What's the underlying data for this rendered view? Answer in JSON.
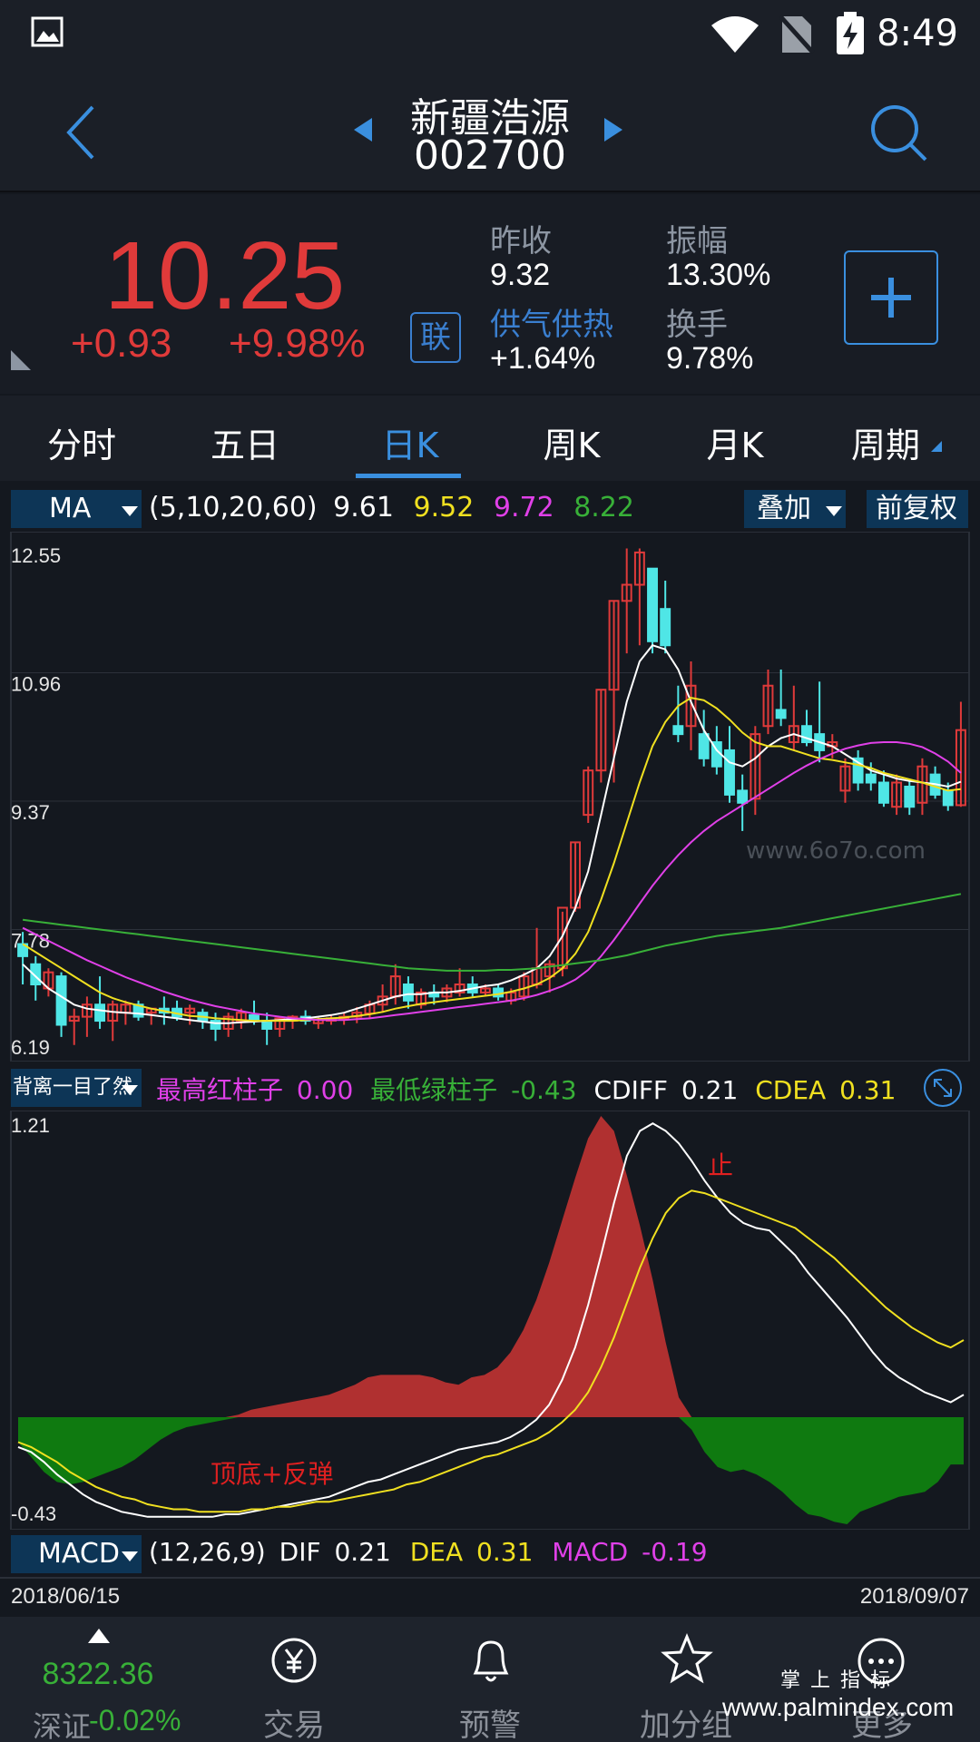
{
  "status_bar": {
    "time": "8:49"
  },
  "header": {
    "stock_name": "新疆浩源",
    "stock_code": "002700"
  },
  "quote": {
    "price": "10.25",
    "change": "+0.93",
    "change_pct": "+9.98%",
    "lian_badge": "联",
    "prev_close_label": "昨收",
    "prev_close": "9.32",
    "amplitude_label": "振幅",
    "amplitude": "13.30%",
    "sector_label": "供气供热",
    "sector_change": "+1.64%",
    "turnover_label": "换手",
    "turnover": "9.78%"
  },
  "tabs": [
    {
      "label": "分时"
    },
    {
      "label": "五日"
    },
    {
      "label": "日K"
    },
    {
      "label": "周K"
    },
    {
      "label": "月K"
    },
    {
      "label": "周期"
    }
  ],
  "active_tab": "日K",
  "ma_bar": {
    "selector": "MA",
    "params": "(5,10,20,60)",
    "ma5": "9.61",
    "ma10": "9.52",
    "ma20": "9.72",
    "ma60": "8.22",
    "overlay_btn": "叠加",
    "adjust_btn": "前复权"
  },
  "watermark": "www.6o7o.com",
  "ind_bar": {
    "selector": "背离一目了然",
    "red_label": "最高红柱子",
    "red_val": "0.00",
    "green_label": "最低绿柱子",
    "green_val": "-0.43",
    "cdiff_label": "CDIFF",
    "cdiff_val": "0.21",
    "cdea_label": "CDEA",
    "cdea_val": "0.31"
  },
  "annotations": {
    "stop": "止",
    "bounce": "顶底+反弹"
  },
  "macd_bar": {
    "selector": "MACD",
    "params": "(12,26,9)",
    "dif_label": "DIF",
    "dif_val": "0.21",
    "dea_label": "DEA",
    "dea_val": "0.31",
    "macd_label": "MACD",
    "macd_val": "-0.19"
  },
  "dates": {
    "start": "2018/06/15",
    "end": "2018/09/07"
  },
  "bottom_nav": {
    "index_value": "8322.36",
    "index_name": "深证",
    "index_change": "-0.02%",
    "items": [
      "交易",
      "预警",
      "加分组",
      "更多"
    ]
  },
  "bottom_watermark": {
    "top": "掌 上 指 标",
    "url": "www.palmindex.com"
  },
  "colors": {
    "up": "#e03a3a",
    "down": "#4fe6e6",
    "accent": "#3a8fdf",
    "ma5": "#ffffff",
    "ma10": "#f0e020",
    "ma20": "#e040e8",
    "ma60": "#38b038"
  },
  "chart_data": [
    {
      "type": "candlestick",
      "ylim": [
        6.19,
        12.55
      ],
      "y_ticks": [
        "12.55",
        "10.96",
        "9.37",
        "7.78",
        "6.19"
      ],
      "ohlc": [
        [
          7.6,
          7.75,
          7.1,
          7.45
        ],
        [
          7.35,
          7.45,
          6.9,
          7.1
        ],
        [
          7.05,
          7.3,
          6.95,
          7.25
        ],
        [
          7.2,
          7.25,
          6.45,
          6.6
        ],
        [
          6.65,
          6.8,
          6.35,
          6.7
        ],
        [
          6.7,
          6.95,
          6.45,
          6.85
        ],
        [
          6.85,
          7.2,
          6.55,
          6.65
        ],
        [
          6.65,
          6.9,
          6.4,
          6.85
        ],
        [
          6.75,
          6.9,
          6.6,
          6.85
        ],
        [
          6.85,
          6.9,
          6.65,
          6.7
        ],
        [
          6.75,
          6.8,
          6.6,
          6.8
        ],
        [
          6.8,
          6.95,
          6.6,
          6.75
        ],
        [
          6.8,
          6.9,
          6.65,
          6.7
        ],
        [
          6.75,
          6.85,
          6.6,
          6.8
        ],
        [
          6.75,
          6.8,
          6.55,
          6.65
        ],
        [
          6.65,
          6.75,
          6.4,
          6.55
        ],
        [
          6.55,
          6.75,
          6.45,
          6.7
        ],
        [
          6.65,
          6.8,
          6.55,
          6.75
        ],
        [
          6.72,
          6.9,
          6.6,
          6.65
        ],
        [
          6.65,
          6.75,
          6.35,
          6.55
        ],
        [
          6.55,
          6.7,
          6.45,
          6.68
        ],
        [
          6.65,
          6.72,
          6.55,
          6.7
        ],
        [
          6.7,
          6.78,
          6.6,
          6.65
        ],
        [
          6.62,
          6.7,
          6.55,
          6.66
        ],
        [
          6.65,
          6.72,
          6.6,
          6.68
        ],
        [
          6.68,
          6.75,
          6.6,
          6.7
        ],
        [
          6.7,
          6.82,
          6.62,
          6.75
        ],
        [
          6.74,
          6.9,
          6.68,
          6.85
        ],
        [
          6.85,
          7.1,
          6.75,
          6.95
        ],
        [
          6.95,
          7.35,
          6.85,
          7.2
        ],
        [
          7.1,
          7.2,
          6.8,
          6.9
        ],
        [
          6.85,
          7.05,
          6.8,
          7.0
        ],
        [
          7.0,
          7.1,
          6.85,
          6.95
        ],
        [
          6.95,
          7.1,
          6.88,
          7.05
        ],
        [
          7.0,
          7.3,
          6.95,
          7.1
        ],
        [
          7.1,
          7.2,
          6.95,
          7.0
        ],
        [
          7.0,
          7.1,
          6.95,
          7.05
        ],
        [
          7.05,
          7.1,
          6.9,
          6.95
        ],
        [
          6.9,
          7.05,
          6.85,
          7.0
        ],
        [
          6.95,
          7.25,
          6.9,
          7.2
        ],
        [
          7.1,
          7.8,
          7.05,
          7.3
        ],
        [
          7.2,
          7.4,
          7.0,
          7.35
        ],
        [
          7.3,
          8.0,
          7.2,
          8.05
        ],
        [
          8.05,
          8.86,
          8.0,
          8.86
        ],
        [
          9.2,
          9.8,
          9.1,
          9.75
        ],
        [
          9.75,
          10.75,
          9.6,
          10.75
        ],
        [
          10.75,
          11.85,
          9.6,
          11.85
        ],
        [
          11.85,
          12.5,
          11.2,
          12.05
        ],
        [
          12.05,
          12.5,
          11.3,
          12.45
        ],
        [
          12.25,
          12.25,
          11.2,
          11.35
        ],
        [
          11.75,
          12.1,
          11.2,
          11.3
        ],
        [
          10.3,
          10.8,
          10.1,
          10.2
        ],
        [
          10.3,
          11.1,
          10.0,
          10.8
        ],
        [
          10.2,
          10.5,
          9.8,
          9.9
        ],
        [
          10.1,
          10.3,
          9.7,
          9.8
        ],
        [
          10.0,
          10.3,
          9.35,
          9.45
        ],
        [
          9.5,
          9.7,
          9.0,
          9.35
        ],
        [
          9.4,
          10.3,
          9.2,
          10.2
        ],
        [
          10.3,
          11.0,
          10.2,
          10.8
        ],
        [
          10.5,
          11.0,
          10.3,
          10.4
        ],
        [
          10.1,
          10.8,
          10.0,
          10.3
        ],
        [
          10.3,
          10.5,
          10.05,
          10.1
        ],
        [
          10.2,
          10.85,
          9.85,
          10.0
        ],
        [
          10.05,
          10.2,
          9.9,
          10.1
        ],
        [
          9.5,
          9.9,
          9.35,
          9.8
        ],
        [
          9.9,
          10.0,
          9.5,
          9.6
        ],
        [
          9.7,
          9.85,
          9.5,
          9.6
        ],
        [
          9.6,
          9.75,
          9.3,
          9.35
        ],
        [
          9.3,
          9.7,
          9.2,
          9.6
        ],
        [
          9.55,
          9.65,
          9.2,
          9.3
        ],
        [
          9.35,
          9.9,
          9.2,
          9.8
        ],
        [
          9.7,
          9.8,
          9.4,
          9.45
        ],
        [
          9.5,
          9.6,
          9.25,
          9.32
        ],
        [
          9.32,
          10.6,
          9.3,
          10.25
        ]
      ],
      "series": [
        {
          "name": "MA5",
          "color": "#ffffff",
          "values": [
            7.35,
            7.2,
            7.05,
            6.95,
            6.85,
            6.8,
            6.78,
            6.76,
            6.75,
            6.74,
            6.72,
            6.7,
            6.68,
            6.66,
            6.64,
            6.62,
            6.62,
            6.63,
            6.64,
            6.65,
            6.66,
            6.67,
            6.68,
            6.7,
            6.72,
            6.75,
            6.8,
            6.85,
            6.9,
            6.95,
            6.98,
            6.98,
            7.0,
            7.0,
            7.02,
            7.05,
            7.08,
            7.1,
            7.15,
            7.22,
            7.3,
            7.45,
            7.7,
            8.05,
            8.5,
            9.2,
            9.9,
            10.6,
            11.1,
            11.3,
            11.25,
            11.0,
            10.6,
            10.25,
            10.0,
            9.85,
            9.8,
            9.9,
            10.05,
            10.15,
            10.2,
            10.15,
            10.1,
            10.05,
            9.95,
            9.85,
            9.75,
            9.7,
            9.65,
            9.62,
            9.6,
            9.58,
            9.55,
            9.61
          ]
        },
        {
          "name": "MA10",
          "color": "#f0e020",
          "values": [
            7.6,
            7.5,
            7.4,
            7.3,
            7.2,
            7.1,
            7.0,
            6.93,
            6.88,
            6.84,
            6.8,
            6.77,
            6.74,
            6.71,
            6.7,
            6.68,
            6.67,
            6.66,
            6.65,
            6.65,
            6.65,
            6.65,
            6.66,
            6.67,
            6.68,
            6.69,
            6.71,
            6.73,
            6.76,
            6.8,
            6.83,
            6.86,
            6.88,
            6.9,
            6.92,
            6.94,
            6.96,
            6.98,
            7.01,
            7.05,
            7.1,
            7.18,
            7.3,
            7.48,
            7.75,
            8.15,
            8.6,
            9.1,
            9.6,
            10.05,
            10.35,
            10.55,
            10.65,
            10.62,
            10.52,
            10.38,
            10.22,
            10.1,
            10.05,
            10.05,
            10.0,
            9.95,
            9.9,
            9.88,
            9.85,
            9.82,
            9.78,
            9.72,
            9.68,
            9.64,
            9.6,
            9.55,
            9.5,
            9.52
          ]
        },
        {
          "name": "MA20",
          "color": "#e040e8",
          "values": [
            7.8,
            7.72,
            7.64,
            7.56,
            7.48,
            7.4,
            7.33,
            7.26,
            7.19,
            7.13,
            7.07,
            7.01,
            6.96,
            6.91,
            6.87,
            6.83,
            6.8,
            6.77,
            6.74,
            6.72,
            6.7,
            6.68,
            6.67,
            6.66,
            6.66,
            6.66,
            6.67,
            6.68,
            6.7,
            6.72,
            6.74,
            6.76,
            6.78,
            6.8,
            6.82,
            6.84,
            6.86,
            6.88,
            6.9,
            6.93,
            6.97,
            7.02,
            7.08,
            7.16,
            7.28,
            7.45,
            7.65,
            7.87,
            8.1,
            8.32,
            8.52,
            8.7,
            8.86,
            9.0,
            9.12,
            9.22,
            9.32,
            9.42,
            9.52,
            9.62,
            9.72,
            9.81,
            9.89,
            9.96,
            10.02,
            10.06,
            10.09,
            10.1,
            10.1,
            10.08,
            10.04,
            9.96,
            9.86,
            9.72
          ]
        },
        {
          "name": "MA60",
          "color": "#38b038",
          "values": [
            7.9,
            7.88,
            7.86,
            7.84,
            7.82,
            7.8,
            7.78,
            7.76,
            7.74,
            7.72,
            7.7,
            7.68,
            7.66,
            7.64,
            7.62,
            7.6,
            7.58,
            7.56,
            7.54,
            7.52,
            7.5,
            7.48,
            7.46,
            7.44,
            7.42,
            7.4,
            7.38,
            7.36,
            7.34,
            7.32,
            7.3,
            7.29,
            7.28,
            7.27,
            7.27,
            7.27,
            7.27,
            7.28,
            7.28,
            7.29,
            7.3,
            7.32,
            7.34,
            7.36,
            7.38,
            7.4,
            7.43,
            7.46,
            7.5,
            7.54,
            7.58,
            7.61,
            7.64,
            7.67,
            7.7,
            7.72,
            7.74,
            7.76,
            7.78,
            7.8,
            7.83,
            7.86,
            7.89,
            7.92,
            7.95,
            7.98,
            8.01,
            8.04,
            8.07,
            8.1,
            8.13,
            8.16,
            8.19,
            8.22
          ]
        }
      ]
    },
    {
      "type": "bar",
      "ylim": [
        -0.43,
        1.21
      ],
      "y_ticks": [
        "1.21",
        "-0.43"
      ],
      "series": [
        {
          "name": "MACD",
          "values": [
            -0.1,
            -0.16,
            -0.22,
            -0.26,
            -0.27,
            -0.26,
            -0.24,
            -0.22,
            -0.2,
            -0.17,
            -0.13,
            -0.09,
            -0.06,
            -0.04,
            -0.03,
            -0.02,
            -0.01,
            0.01,
            0.03,
            0.04,
            0.05,
            0.06,
            0.07,
            0.08,
            0.09,
            0.11,
            0.13,
            0.16,
            0.17,
            0.17,
            0.17,
            0.17,
            0.16,
            0.14,
            0.13,
            0.16,
            0.17,
            0.2,
            0.26,
            0.35,
            0.47,
            0.62,
            0.79,
            0.96,
            1.12,
            1.21,
            1.15,
            0.97,
            0.77,
            0.55,
            0.3,
            0.08,
            -0.05,
            -0.14,
            -0.2,
            -0.22,
            -0.21,
            -0.23,
            -0.26,
            -0.3,
            -0.35,
            -0.39,
            -0.4,
            -0.42,
            -0.43,
            -0.38,
            -0.36,
            -0.34,
            -0.32,
            -0.31,
            -0.3,
            -0.26,
            -0.19,
            -0.19
          ]
        },
        {
          "name": "DIF",
          "values": [
            -0.12,
            -0.14,
            -0.18,
            -0.23,
            -0.27,
            -0.31,
            -0.34,
            -0.36,
            -0.38,
            -0.39,
            -0.4,
            -0.4,
            -0.4,
            -0.4,
            -0.4,
            -0.4,
            -0.39,
            -0.39,
            -0.38,
            -0.37,
            -0.36,
            -0.35,
            -0.34,
            -0.33,
            -0.32,
            -0.3,
            -0.28,
            -0.26,
            -0.25,
            -0.23,
            -0.21,
            -0.19,
            -0.17,
            -0.15,
            -0.13,
            -0.12,
            -0.11,
            -0.1,
            -0.08,
            -0.05,
            -0.01,
            0.05,
            0.15,
            0.28,
            0.45,
            0.65,
            0.86,
            1.05,
            1.15,
            1.18,
            1.15,
            1.1,
            1.03,
            0.95,
            0.88,
            0.82,
            0.78,
            0.76,
            0.75,
            0.7,
            0.65,
            0.58,
            0.52,
            0.46,
            0.4,
            0.33,
            0.26,
            0.2,
            0.16,
            0.13,
            0.1,
            0.08,
            0.06,
            0.09
          ]
        },
        {
          "name": "DEA",
          "values": [
            -0.1,
            -0.12,
            -0.15,
            -0.18,
            -0.22,
            -0.25,
            -0.28,
            -0.3,
            -0.32,
            -0.33,
            -0.35,
            -0.36,
            -0.37,
            -0.37,
            -0.38,
            -0.38,
            -0.38,
            -0.38,
            -0.37,
            -0.37,
            -0.36,
            -0.36,
            -0.35,
            -0.34,
            -0.34,
            -0.33,
            -0.32,
            -0.31,
            -0.3,
            -0.29,
            -0.27,
            -0.26,
            -0.24,
            -0.22,
            -0.2,
            -0.18,
            -0.16,
            -0.15,
            -0.13,
            -0.11,
            -0.09,
            -0.06,
            -0.02,
            0.03,
            0.1,
            0.2,
            0.32,
            0.46,
            0.6,
            0.72,
            0.82,
            0.88,
            0.91,
            0.9,
            0.88,
            0.86,
            0.84,
            0.82,
            0.8,
            0.78,
            0.76,
            0.72,
            0.68,
            0.64,
            0.59,
            0.54,
            0.49,
            0.44,
            0.4,
            0.36,
            0.33,
            0.3,
            0.28,
            0.31
          ]
        }
      ]
    }
  ]
}
